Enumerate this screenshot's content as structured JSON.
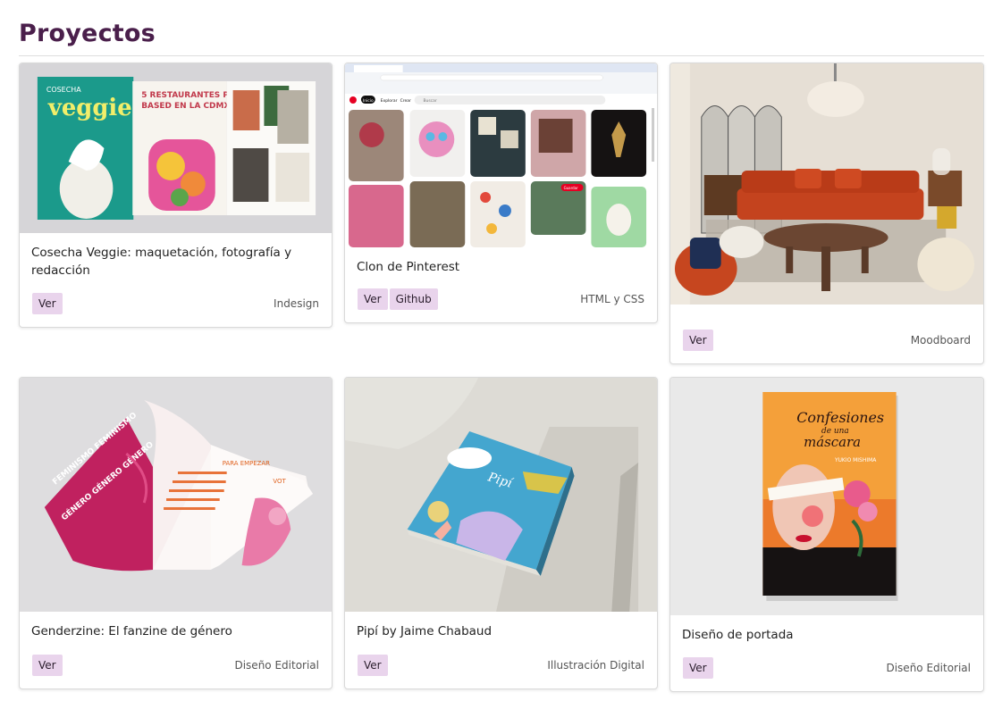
{
  "page": {
    "title": "Proyectos"
  },
  "projects": [
    {
      "title": "Cosecha Veggie: maquetación, fotografía y redacción",
      "buttons": [
        "Ver"
      ],
      "tech": "Indesign",
      "image": "magazine-spread",
      "cover_text": [
        "COSECHA",
        "veggie",
        "5 RESTAURANTES PLANT BASED EN LA CDMX"
      ]
    },
    {
      "title": "Clon de Pinterest",
      "buttons": [
        "Ver",
        "Github"
      ],
      "tech": "HTML y CSS",
      "image": "pinterest-clone-screenshot",
      "ui_text": [
        "Inicio",
        "Explorar",
        "Crear",
        "Buscar",
        "Guardar"
      ]
    },
    {
      "title": "",
      "buttons": [
        "Ver"
      ],
      "tech": "Moodboard",
      "image": "living-room-moodboard"
    },
    {
      "title": "Genderzine: El fanzine de género",
      "buttons": [
        "Ver"
      ],
      "tech": "Diseño Editorial",
      "image": "fanzine-mockup",
      "zine_text": [
        "PARA EMPEZAR",
        "VOT"
      ]
    },
    {
      "title": "Pipí by Jaime Chabaud",
      "buttons": [
        "Ver"
      ],
      "tech": "Illustración Digital",
      "image": "book-pipi",
      "book_text": "Pipí"
    },
    {
      "title": "Diseño de portada",
      "buttons": [
        "Ver"
      ],
      "tech": "Diseño Editorial",
      "image": "book-cover",
      "cover_text": [
        "Confesiones",
        "de una",
        "máscara",
        "YUKIO MISHIMA"
      ]
    }
  ]
}
